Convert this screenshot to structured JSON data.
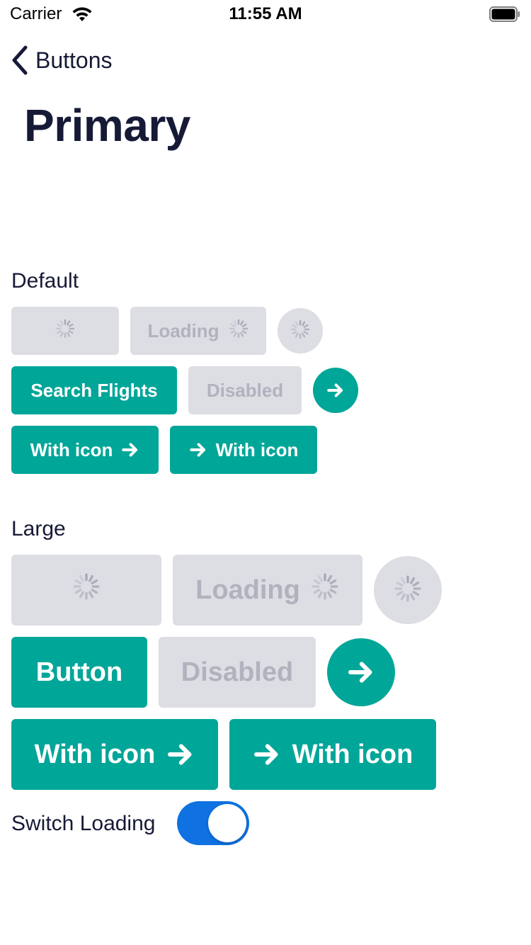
{
  "status_bar": {
    "carrier": "Carrier",
    "time": "11:55 AM"
  },
  "nav": {
    "back_label": "Buttons"
  },
  "page": {
    "title": "Primary"
  },
  "default_section": {
    "label": "Default",
    "loading_label": "Loading",
    "primary_label": "Search Flights",
    "disabled_label": "Disabled",
    "icon_trailing_label": "With icon",
    "icon_leading_label": "With icon"
  },
  "large_section": {
    "label": "Large",
    "loading_label": "Loading",
    "primary_label": "Button",
    "disabled_label": "Disabled",
    "icon_trailing_label": "With icon",
    "icon_leading_label": "With icon"
  },
  "switch": {
    "label": "Switch Loading",
    "on": true
  },
  "colors": {
    "primary": "#00a698",
    "muted_bg": "#dddde4",
    "muted_text": "#b2b2bf",
    "text": "#161a36",
    "switch_on": "#0f71e2"
  },
  "icons": {
    "spinner": "spinner-icon",
    "arrow": "arrow-right-icon",
    "back": "chevron-left-icon"
  }
}
